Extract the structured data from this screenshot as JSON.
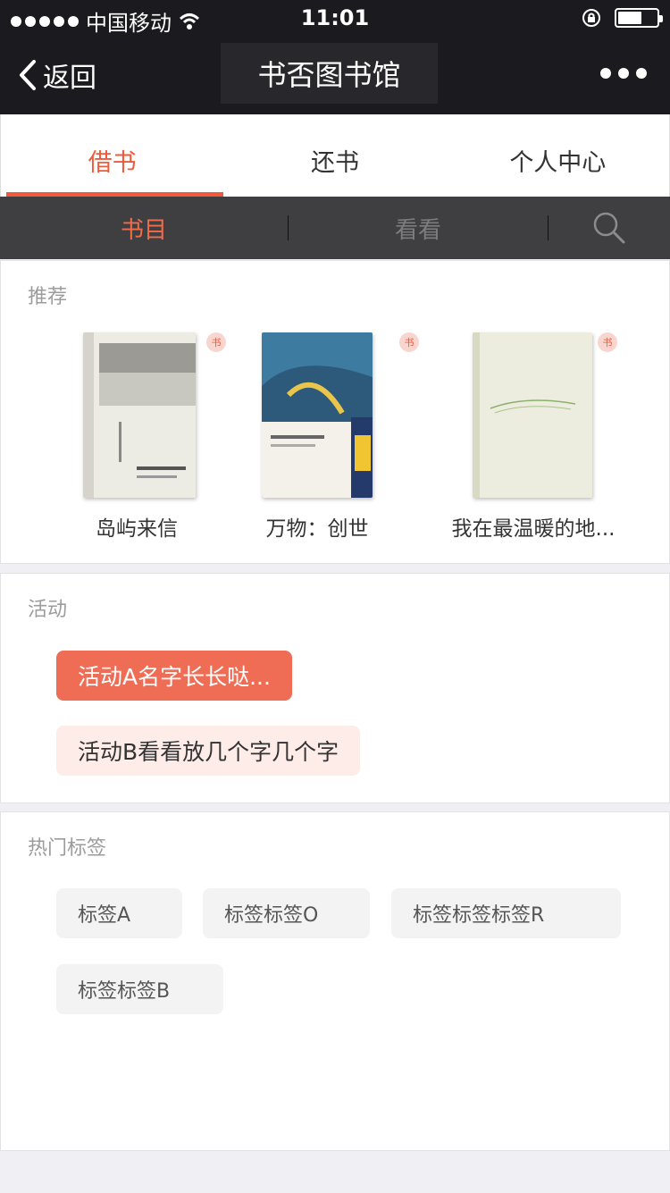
{
  "status": {
    "carrier": "中国移动",
    "time": "11:01"
  },
  "nav": {
    "back_label": "返回",
    "title": "书否图书馆"
  },
  "tabs": [
    {
      "label": "借书"
    },
    {
      "label": "还书"
    },
    {
      "label": "个人中心"
    }
  ],
  "subtabs": [
    {
      "label": "书目"
    },
    {
      "label": "看看"
    }
  ],
  "recommend": {
    "title": "推荐",
    "books": [
      {
        "title": "岛屿来信"
      },
      {
        "title": "万物：创世"
      },
      {
        "title": "我在最温暖的地..."
      }
    ]
  },
  "activities": {
    "title": "活动",
    "items": [
      {
        "label": "活动A名字长长哒..."
      },
      {
        "label": "活动B看看放几个字几个字"
      }
    ]
  },
  "hot_tags": {
    "title": "热门标签",
    "items": [
      {
        "label": "标签A"
      },
      {
        "label": "标签标签O"
      },
      {
        "label": "标签标签标签R"
      },
      {
        "label": "标签标签B"
      }
    ]
  },
  "colors": {
    "accent": "#f05a3a",
    "nav_bg": "#1b1b1f",
    "subtab_bg": "#3f3f42"
  }
}
